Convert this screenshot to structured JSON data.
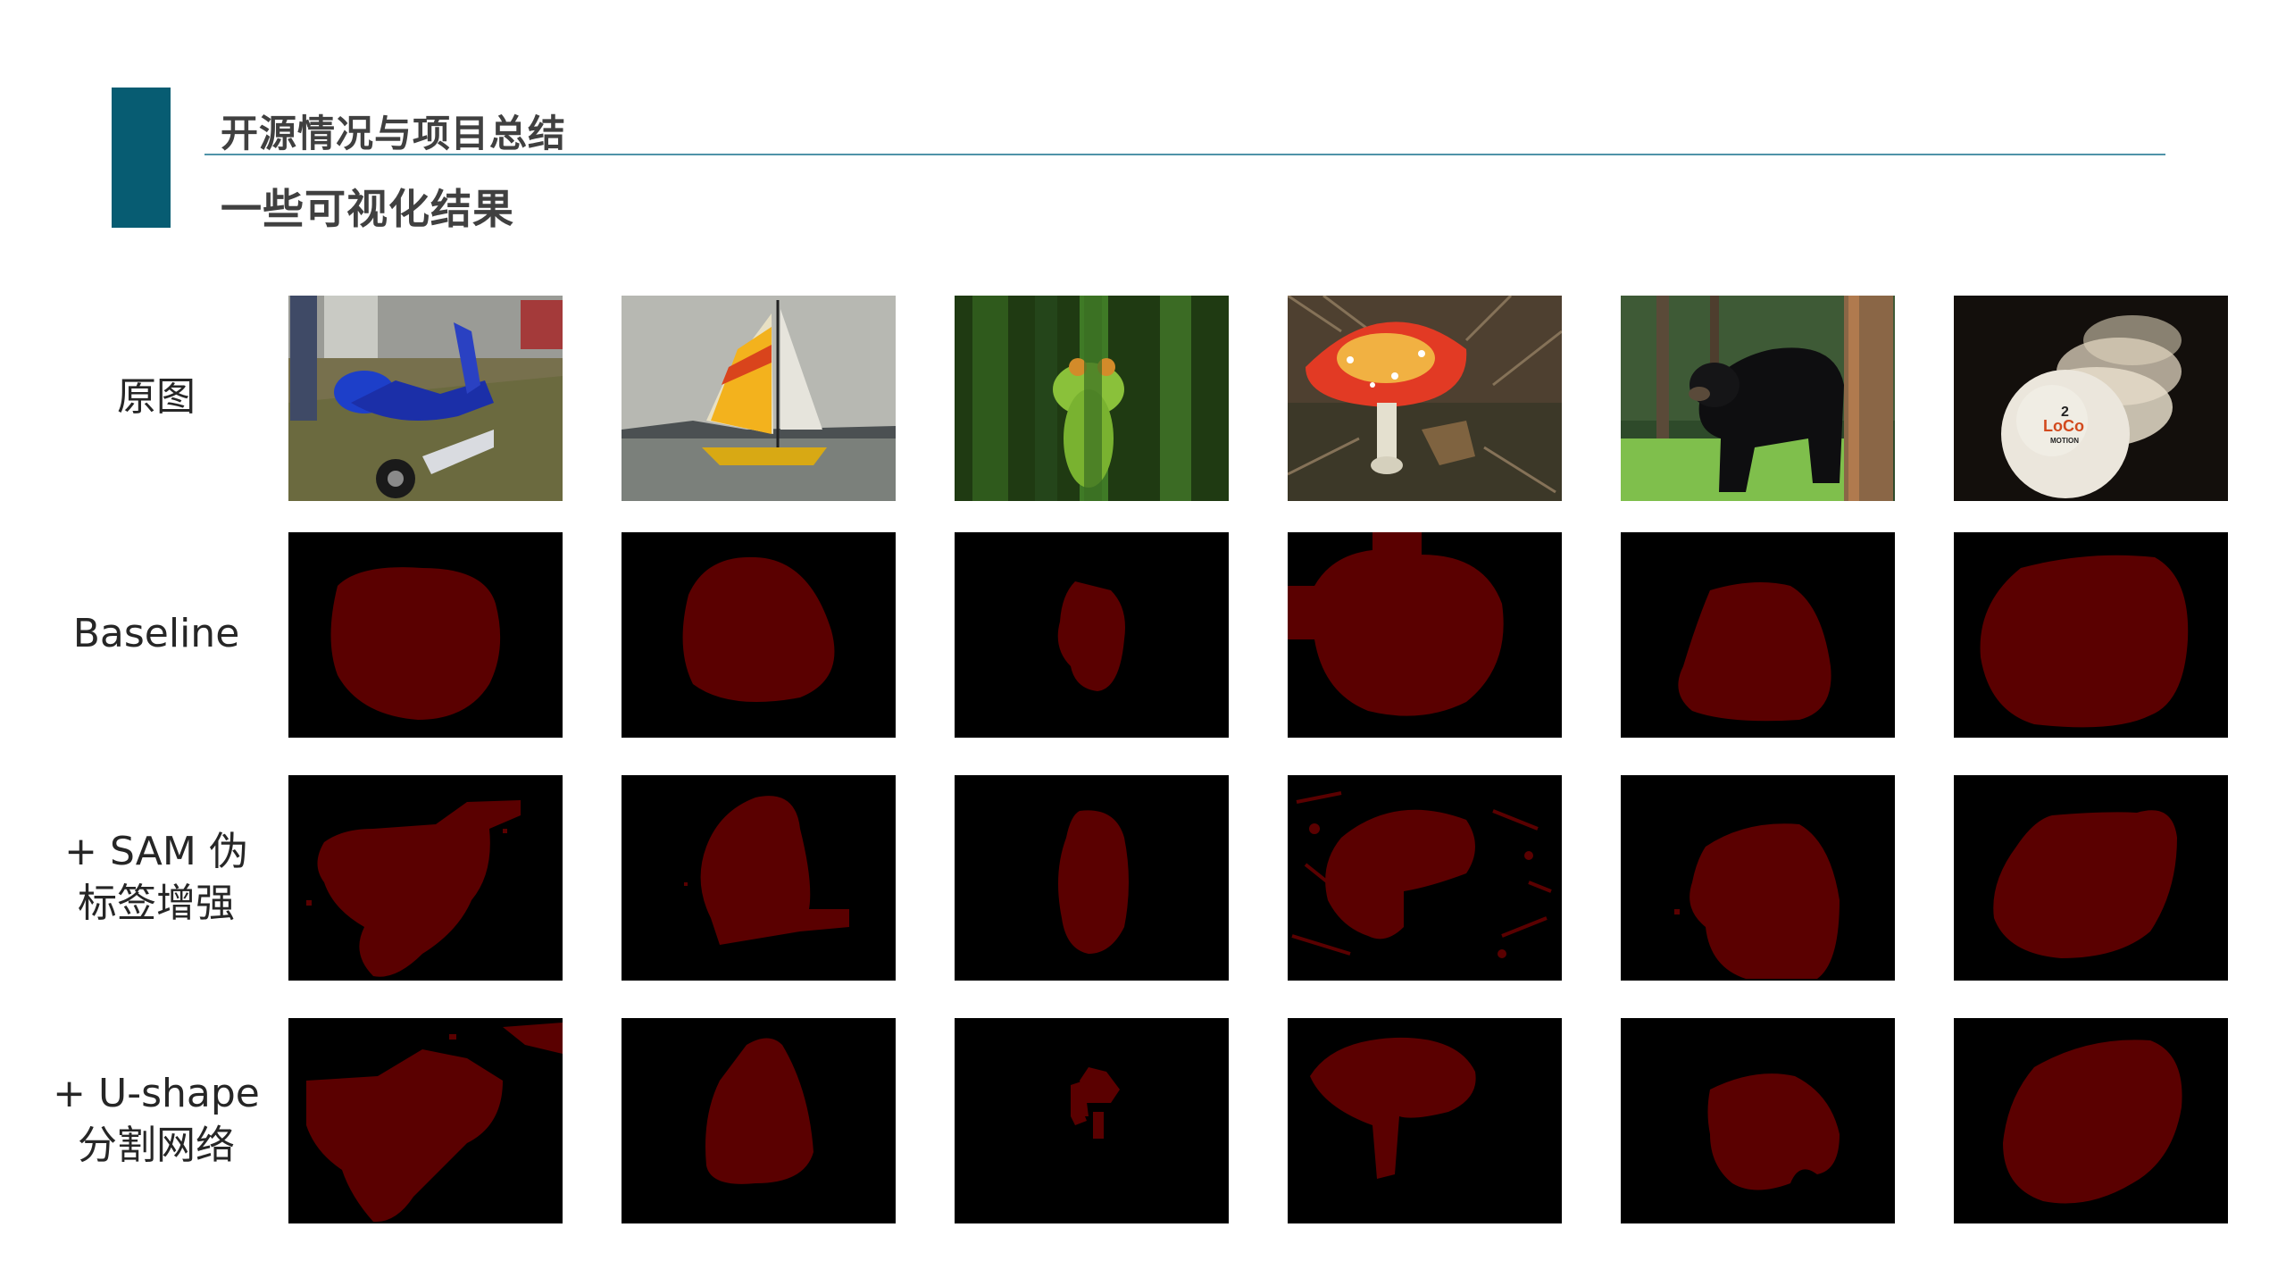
{
  "header": {
    "section_title": "开源情况与项目总结",
    "slide_title": "一些可视化结果",
    "accent_color": "#075c72"
  },
  "rows": [
    {
      "label_line1": "原图",
      "label_line2": ""
    },
    {
      "label_line1": "Baseline",
      "label_line2": ""
    },
    {
      "label_line1": "+ SAM 伪",
      "label_line2": "标签增强"
    },
    {
      "label_line1": "+ U-shape",
      "label_line2": "分割网络"
    }
  ],
  "columns": [
    {
      "subject": "scooter"
    },
    {
      "subject": "sailboat"
    },
    {
      "subject": "frog"
    },
    {
      "subject": "mushroom"
    },
    {
      "subject": "bear"
    },
    {
      "subject": "golf-balls"
    }
  ],
  "images": {
    "golf_ball_text_number": "2",
    "golf_ball_text_brand": "LoCo",
    "golf_ball_text_sub": "MOTION"
  },
  "mask_color": "#5a0000"
}
